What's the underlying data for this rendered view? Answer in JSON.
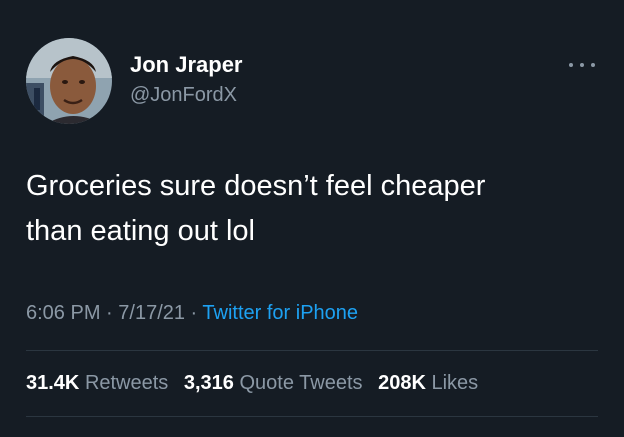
{
  "tweet": {
    "author": {
      "name": "Jon Jraper",
      "handle": "@JonFordX"
    },
    "text_lines": [
      "Groceries sure doesn’t feel cheaper",
      "than eating out lol"
    ],
    "meta": {
      "time": "6:06 PM",
      "separator": " · ",
      "date": "7/17/21",
      "source": "Twitter for iPhone"
    },
    "stats": {
      "retweets_count": "31.4K",
      "retweets_label": "Retweets",
      "quotes_count": "3,316",
      "quotes_label": "Quote Tweets",
      "likes_count": "208K",
      "likes_label": "Likes"
    }
  },
  "colors": {
    "background": "#151c24",
    "primary_text": "#ffffff",
    "secondary_text": "#8b98a5",
    "link": "#1da1f2",
    "divider": "#2b3640"
  },
  "icons": {
    "more": "more-horizontal-icon",
    "avatar": "profile-photo"
  }
}
